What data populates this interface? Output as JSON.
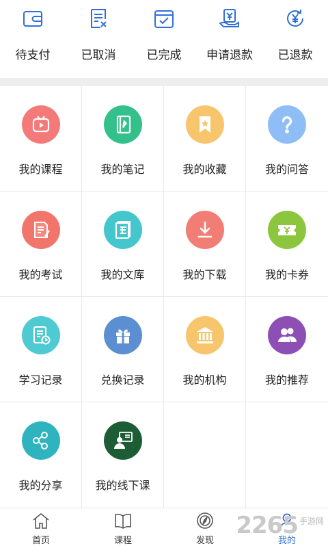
{
  "orders": [
    {
      "label": "待支付",
      "icon": "wallet-icon"
    },
    {
      "label": "已取消",
      "icon": "cancelled-doc-icon"
    },
    {
      "label": "已完成",
      "icon": "completed-check-icon"
    },
    {
      "label": "申请退款",
      "icon": "refund-request-icon"
    },
    {
      "label": "已退款",
      "icon": "refunded-icon"
    }
  ],
  "menu": [
    {
      "label": "我的课程",
      "icon": "tv-play-icon",
      "color": "#f47a7a"
    },
    {
      "label": "我的笔记",
      "icon": "notebook-pen-icon",
      "color": "#33c08a"
    },
    {
      "label": "我的收藏",
      "icon": "bookmark-star-icon",
      "color": "#f7c66c"
    },
    {
      "label": "我的问答",
      "icon": "question-mark-icon",
      "color": "#8fbdf5"
    },
    {
      "label": "我的考试",
      "icon": "exam-paper-icon",
      "color": "#f2756c"
    },
    {
      "label": "我的文库",
      "icon": "library-book-icon",
      "color": "#44c7cc"
    },
    {
      "label": "我的下载",
      "icon": "download-icon",
      "color": "#f27d74"
    },
    {
      "label": "我的卡券",
      "icon": "ticket-icon",
      "color": "#8cc63f"
    },
    {
      "label": "学习记录",
      "icon": "study-record-icon",
      "color": "#4fcad3"
    },
    {
      "label": "兑换记录",
      "icon": "gift-box-icon",
      "color": "#5b8fd1"
    },
    {
      "label": "我的机构",
      "icon": "institution-icon",
      "color": "#f7c66c"
    },
    {
      "label": "我的推荐",
      "icon": "users-icon",
      "color": "#8e4fb5"
    },
    {
      "label": "我的分享",
      "icon": "share-icon",
      "color": "#2fb3bf"
    },
    {
      "label": "我的线下课",
      "icon": "offline-teacher-icon",
      "color": "#1e5c36"
    }
  ],
  "tabs": [
    {
      "label": "首页",
      "icon": "home-icon"
    },
    {
      "label": "课程",
      "icon": "book-icon"
    },
    {
      "label": "发现",
      "icon": "compass-icon"
    },
    {
      "label": "我的",
      "icon": "user-icon"
    }
  ],
  "watermark": {
    "number": "2265",
    "text": "手游网"
  },
  "colors": {
    "accent": "#2f6fd6",
    "separator": "#eeeeee",
    "grid_line": "#e9e9e9"
  }
}
